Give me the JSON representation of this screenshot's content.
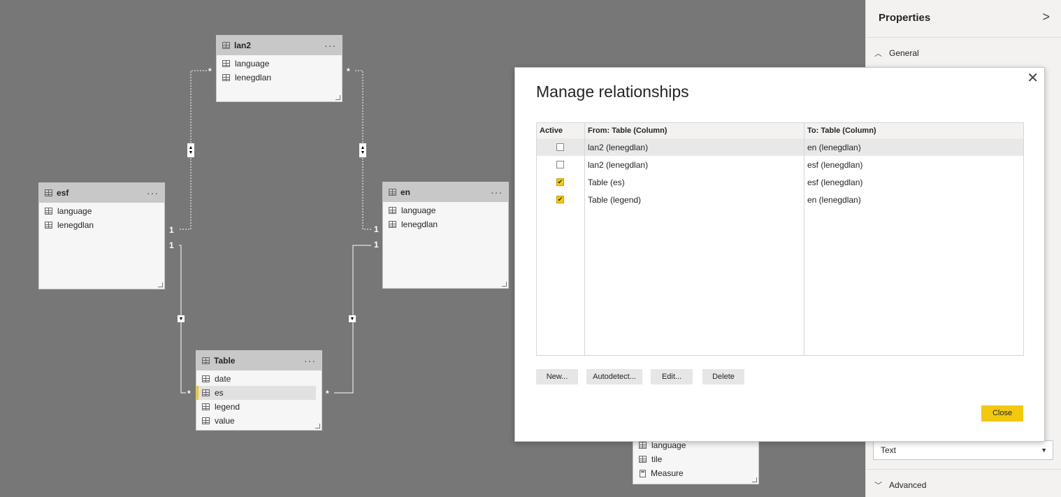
{
  "tables": {
    "lan2": {
      "name": "lan2",
      "more": "···",
      "columns": [
        "language",
        "lenegdlan"
      ]
    },
    "esf": {
      "name": "esf",
      "more": "···",
      "columns": [
        "language",
        "lenegdlan"
      ]
    },
    "en": {
      "name": "en",
      "more": "···",
      "columns": [
        "language",
        "lenegdlan"
      ]
    },
    "table": {
      "name": "Table",
      "more": "···",
      "columns": [
        "date",
        "es",
        "legend",
        "value"
      ],
      "selected_column": "es"
    },
    "partial": {
      "columns": [
        "language",
        "tile",
        "Measure"
      ]
    }
  },
  "relationship_labels": {
    "lan2_esf_from": "*",
    "lan2_esf_to": "1",
    "lan2_en_from": "*",
    "lan2_en_to": "1",
    "table_esf_from": "*",
    "table_esf_to": "1",
    "table_en_from": "*",
    "table_en_to": "1"
  },
  "properties": {
    "title": "Properties",
    "chevron": ">",
    "general_label": "General",
    "data_type_value": "Text",
    "advanced_label": "Advanced"
  },
  "dialog": {
    "title": "Manage relationships",
    "close_symbol": "✕",
    "headers": {
      "active": "Active",
      "from": "From: Table (Column)",
      "to": "To: Table (Column)"
    },
    "rows": [
      {
        "active": false,
        "from": "lan2 (lenegdlan)",
        "to": "en (lenegdlan)"
      },
      {
        "active": false,
        "from": "lan2 (lenegdlan)",
        "to": "esf (lenegdlan)"
      },
      {
        "active": true,
        "from": "Table (es)",
        "to": "esf (lenegdlan)"
      },
      {
        "active": true,
        "from": "Table (legend)",
        "to": "en (lenegdlan)"
      }
    ],
    "buttons": {
      "new": "New...",
      "autodetect": "Autodetect...",
      "edit": "Edit...",
      "delete": "Delete",
      "close": "Close"
    }
  },
  "colors": {
    "canvas": "#777777",
    "accent": "#f2c811",
    "table_header": "#c8c8c8"
  },
  "icons": [
    "table-icon",
    "column-icon",
    "measure-icon",
    "more-options-icon",
    "close-icon",
    "chevron-right-icon",
    "chevron-up-icon",
    "chevron-down-icon",
    "cross-filter-arrow-icon"
  ]
}
